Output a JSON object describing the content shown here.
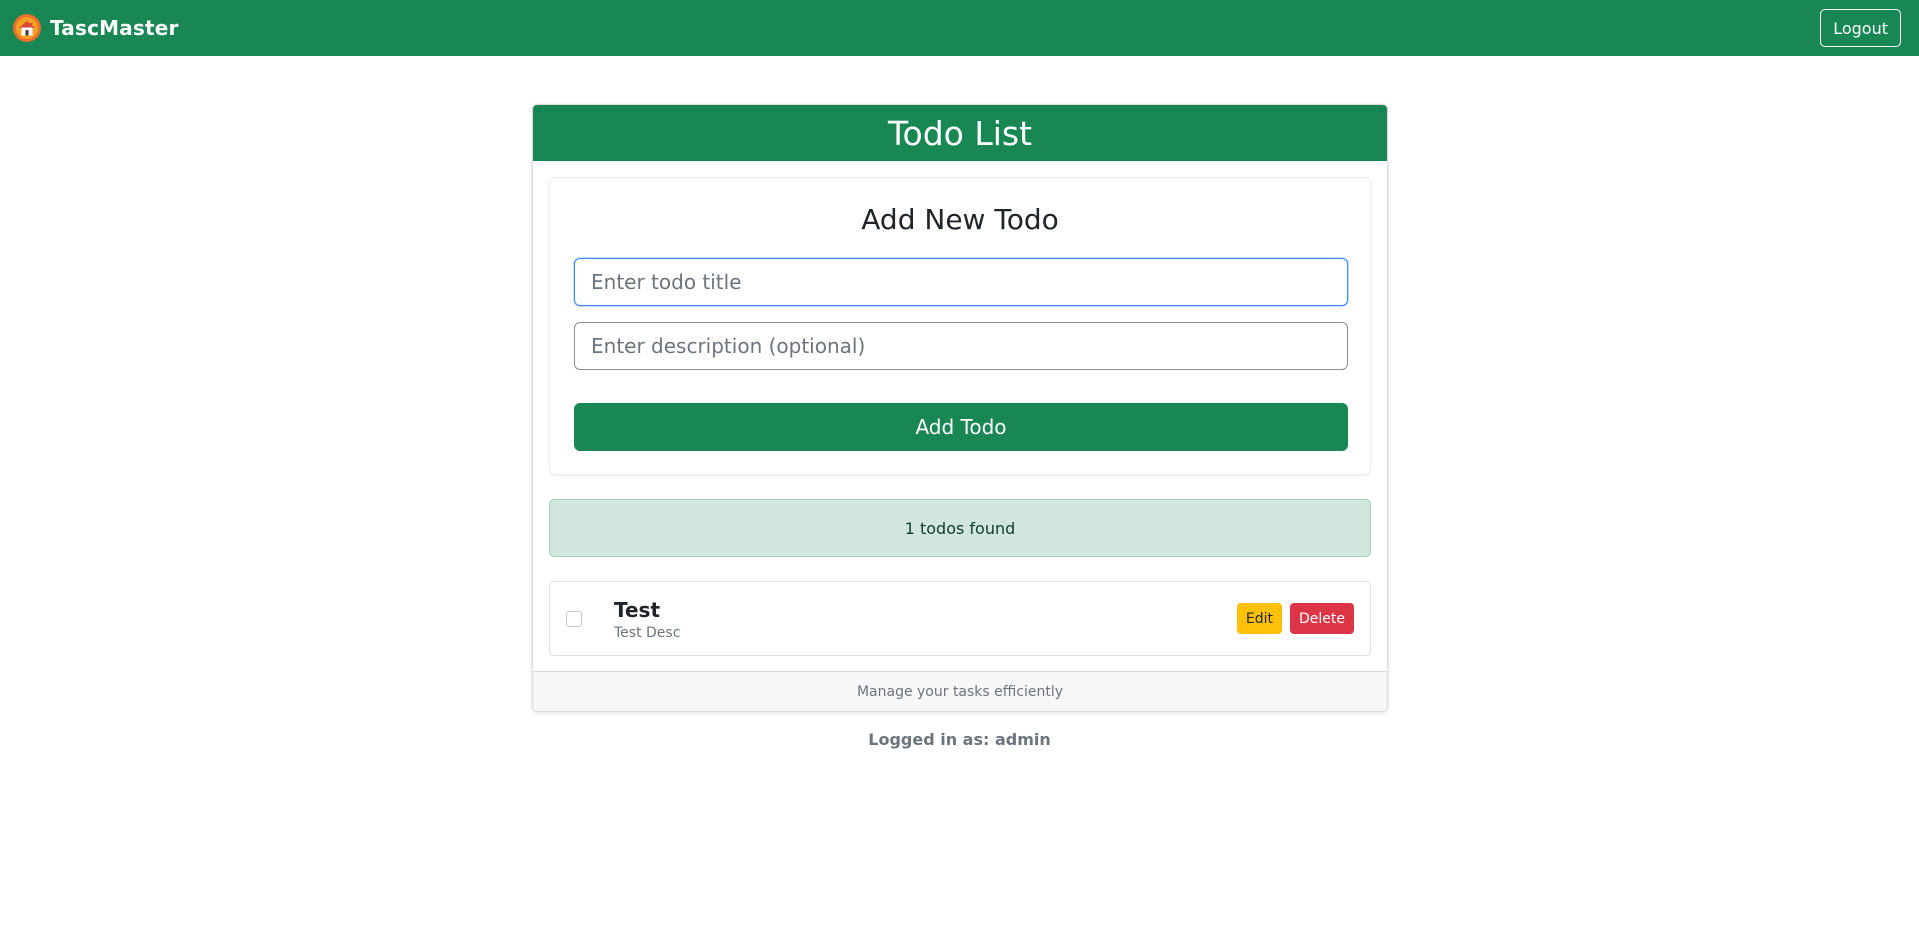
{
  "navbar": {
    "brand": "TascMaster",
    "logout_label": "Logout",
    "logo_icon": "house-logo-icon"
  },
  "card": {
    "title": "Todo List",
    "footer": "Manage your tasks efficiently"
  },
  "form": {
    "heading": "Add New Todo",
    "title_placeholder": "Enter todo title",
    "description_placeholder": "Enter description (optional)",
    "submit_label": "Add Todo"
  },
  "status": {
    "count_text": "1 todos found"
  },
  "todos": [
    {
      "title": "Test",
      "description": "Test Desc",
      "completed": false,
      "edit_label": "Edit",
      "delete_label": "Delete"
    }
  ],
  "session": {
    "logged_in_text": "Logged in as: admin"
  },
  "colors": {
    "primary": "#198754",
    "warning": "#ffc107",
    "danger": "#dc3545",
    "success_bg": "#d1e7dd",
    "focus": "#3d8bfd"
  }
}
